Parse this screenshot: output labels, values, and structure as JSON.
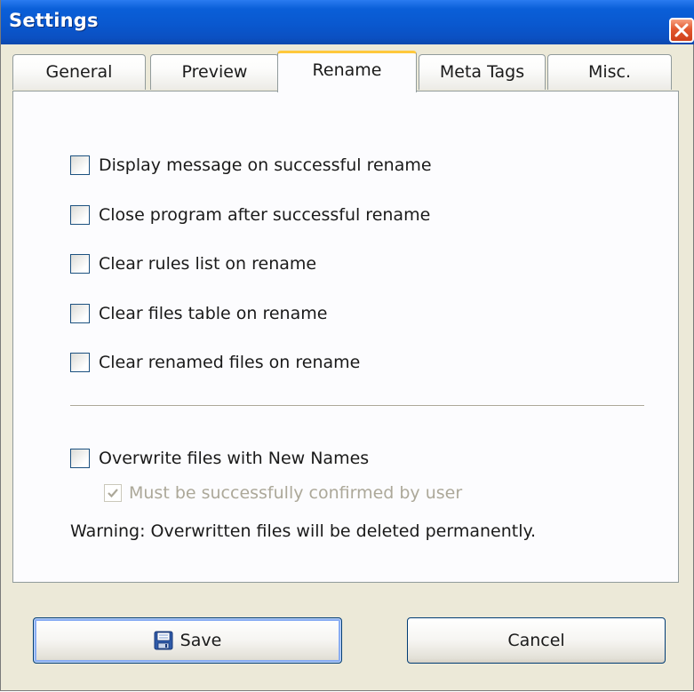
{
  "window": {
    "title": "Settings",
    "close_icon": "close-x-icon"
  },
  "tabs": [
    {
      "label": "General",
      "active": false
    },
    {
      "label": "Preview",
      "active": false
    },
    {
      "label": "Rename",
      "active": true
    },
    {
      "label": "Meta Tags",
      "active": false
    },
    {
      "label": "Misc.",
      "active": false
    }
  ],
  "options": [
    {
      "label": "Display message on successful rename",
      "checked": false
    },
    {
      "label": "Close program after successful rename",
      "checked": false
    },
    {
      "label": "Clear rules list on rename",
      "checked": false
    },
    {
      "label": "Clear files table on rename",
      "checked": false
    },
    {
      "label": "Clear renamed files on rename",
      "checked": false
    }
  ],
  "overwrite": {
    "label": "Overwrite files with New Names",
    "checked": false,
    "confirm": {
      "label": "Must be successfully confirmed by user",
      "checked": true,
      "enabled": false
    },
    "warning": "Warning: Overwritten files will be deleted permanently."
  },
  "buttons": {
    "save": {
      "label": "Save",
      "icon": "floppy-disk-icon"
    },
    "cancel": {
      "label": "Cancel"
    }
  },
  "colors": {
    "titlebar": "#0a58cf",
    "active_tab_highlight": "#ffc83c",
    "checkbox_border": "#1c5180"
  }
}
